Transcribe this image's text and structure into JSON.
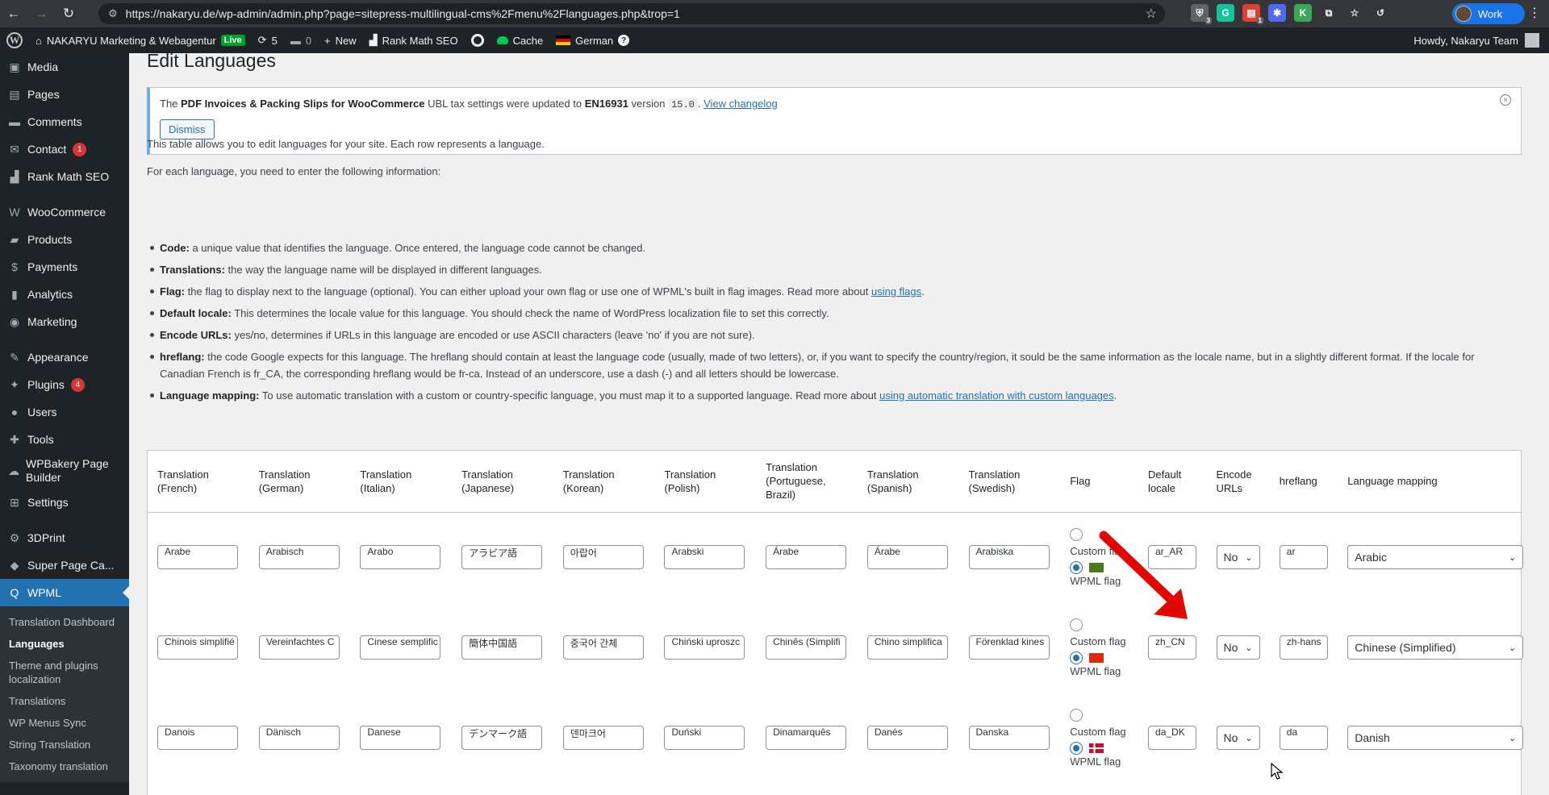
{
  "browser": {
    "url": "https://nakaryu.de/wp-admin/admin.php?page=sitepress-multilingual-cms%2Fmenu%2Flanguages.php&trop=1",
    "profile_label": "Work",
    "extensions": [
      {
        "icon": "shield-icon",
        "badge": "3",
        "color": "#5f6368",
        "glyph": "⛨"
      },
      {
        "icon": "grammarly-icon",
        "badge": "",
        "color": "#15c39a",
        "glyph": "G"
      },
      {
        "icon": "todoist-icon",
        "badge": "1",
        "color": "#db4035",
        "glyph": "▤"
      },
      {
        "icon": "puzzle-blue-icon",
        "badge": "",
        "color": "#4f6bed",
        "glyph": "✱"
      },
      {
        "icon": "k-icon",
        "badge": "",
        "color": "#3aa757",
        "glyph": "K"
      },
      {
        "icon": "extensions-icon",
        "badge": "",
        "color": "#35363a",
        "glyph": "⧉"
      }
    ]
  },
  "adminbar": {
    "site_name": "NAKARYU Marketing & Webagentur",
    "live_label": "Live",
    "updates_count": "5",
    "comments_count": "0",
    "new_label": "New",
    "rankmath_label": "Rank Math SEO",
    "cache_label": "Cache",
    "language_label": "German",
    "howdy": "Howdy, Nakaryu Team"
  },
  "sidebar": {
    "items": [
      {
        "label": "Media",
        "icon": "media-icon",
        "glyph": "▣",
        "badge": ""
      },
      {
        "label": "Pages",
        "icon": "pages-icon",
        "glyph": "▤",
        "badge": ""
      },
      {
        "label": "Comments",
        "icon": "comments-icon",
        "glyph": "▬",
        "badge": ""
      },
      {
        "label": "Contact",
        "icon": "mail-icon",
        "glyph": "✉",
        "badge": "1"
      },
      {
        "label": "Rank Math SEO",
        "icon": "rankmath-icon",
        "glyph": "▟",
        "badge": ""
      }
    ],
    "items2": [
      {
        "label": "WooCommerce",
        "icon": "woocommerce-icon",
        "glyph": "W",
        "badge": ""
      },
      {
        "label": "Products",
        "icon": "products-icon",
        "glyph": "▰",
        "badge": ""
      },
      {
        "label": "Payments",
        "icon": "payments-icon",
        "glyph": "$",
        "badge": ""
      },
      {
        "label": "Analytics",
        "icon": "analytics-icon",
        "glyph": "▮",
        "badge": ""
      },
      {
        "label": "Marketing",
        "icon": "marketing-icon",
        "glyph": "◉",
        "badge": ""
      }
    ],
    "items3": [
      {
        "label": "Appearance",
        "icon": "appearance-icon",
        "glyph": "✎",
        "badge": ""
      },
      {
        "label": "Plugins",
        "icon": "plugins-icon",
        "glyph": "✦",
        "badge": "4"
      },
      {
        "label": "Users",
        "icon": "users-icon",
        "glyph": "●",
        "badge": ""
      },
      {
        "label": "Tools",
        "icon": "tools-icon",
        "glyph": "✚",
        "badge": ""
      },
      {
        "label": "WPBakery Page Builder",
        "icon": "wpbakery-icon",
        "glyph": "☁",
        "badge": ""
      },
      {
        "label": "Settings",
        "icon": "settings-icon",
        "glyph": "⊞",
        "badge": ""
      }
    ],
    "items4": [
      {
        "label": "3DPrint",
        "icon": "gear-icon",
        "glyph": "⚙",
        "badge": ""
      },
      {
        "label": "Super Page Ca...",
        "icon": "super-cache-icon",
        "glyph": "◆",
        "badge": ""
      }
    ],
    "current": {
      "label": "WPML",
      "icon": "wpml-icon",
      "glyph": "Q"
    },
    "submenu": [
      "Translation Dashboard",
      "Languages",
      "Theme and plugins localization",
      "Translations",
      "WP Menus Sync",
      "String Translation",
      "Taxonomy translation"
    ]
  },
  "page": {
    "title": "Edit Languages",
    "notice": {
      "text_1": "The ",
      "bold_1": "PDF Invoices & Packing Slips for WooCommerce",
      "text_2": " UBL tax settings were updated to ",
      "bold_2": "EN16931",
      "text_3": " version ",
      "code": "15.0",
      "text_4": ". ",
      "link": "View changelog",
      "dismiss": "Dismiss"
    },
    "intro_1": "This table allows you to edit languages for your site. Each row represents a language.",
    "intro_2": "For each language, you need to enter the following information:",
    "info": [
      {
        "term": "Code:",
        "desc": " a unique value that identifies the language. Once entered, the language code cannot be changed.",
        "link": "",
        "after": ""
      },
      {
        "term": "Translations:",
        "desc": " the way the language name will be displayed in different languages.",
        "link": "",
        "after": ""
      },
      {
        "term": "Flag:",
        "desc": " the flag to display next to the language (optional). You can either upload your own flag or use one of WPML's built in flag images. Read more about ",
        "link": "using flags",
        "after": "."
      },
      {
        "term": "Default locale:",
        "desc": " This determines the locale value for this language. You should check the name of WordPress localization file to set this correctly.",
        "link": "",
        "after": ""
      },
      {
        "term": "Encode URLs:",
        "desc": " yes/no, determines if URLs in this language are encoded or use ASCII characters (leave 'no' if you are not sure).",
        "link": "",
        "after": ""
      },
      {
        "term": "hreflang:",
        "desc": " the code Google expects for this language. The hreflang should contain at least the language code (usually, made of two letters), or, if you want to specify the country/region, it sould be the same information as the locale name, but in a slightly different format. If the locale for Canadian French is fr_CA, the corresponding hreflang would be fr-ca. Instead of an underscore, use a dash (-) and all letters should be lowercase.",
        "link": "",
        "after": ""
      },
      {
        "term": "Language mapping:",
        "desc": " To use automatic translation with a custom or country-specific language, you must map it to a supported language. Read more about ",
        "link": "using automatic translation with custom languages",
        "after": "."
      }
    ]
  },
  "table": {
    "headers": [
      "Translation (French)",
      "Translation (German)",
      "Translation (Italian)",
      "Translation (Japanese)",
      "Translation (Korean)",
      "Translation (Polish)",
      "Translation (Portuguese, Brazil)",
      "Translation (Spanish)",
      "Translation (Swedish)",
      "Flag",
      "Default locale",
      "Encode URLs",
      "hreflang",
      "Language mapping"
    ],
    "custom_flag_label": "Custom flag",
    "wpml_flag_label": "WPML flag",
    "rows": [
      {
        "translations": [
          "Arabe",
          "Arabisch",
          "Arabo",
          "アラビア語",
          "아랍어",
          "Arabski",
          "Árabe",
          "Árabe",
          "Arabiska"
        ],
        "flag": "flag-ar",
        "locale": "ar_AR",
        "encode": "No",
        "hreflang": "ar",
        "mapping": "Arabic"
      },
      {
        "translations": [
          "Chinois simplifié",
          "Vereinfachtes C",
          "Cinese semplific",
          "簡体中国語",
          "중국어 간체",
          "Chiński uproszc",
          "Chinês (Simplifi",
          "Chino simplifica",
          "Förenklad kines"
        ],
        "flag": "flag-cn",
        "locale": "zh_CN",
        "encode": "No",
        "hreflang": "zh-hans",
        "mapping": "Chinese (Simplified)"
      },
      {
        "translations": [
          "Danois",
          "Dänisch",
          "Danese",
          "デンマーク語",
          "덴마크어",
          "Duński",
          "Dinamarquês",
          "Danés",
          "Danska"
        ],
        "flag": "flag-dk",
        "locale": "da_DK",
        "encode": "No",
        "hreflang": "da",
        "mapping": "Danish"
      }
    ]
  },
  "colors": {
    "accent": "#2271b1",
    "sidebar": "#1d2327",
    "badge": "#d63638",
    "annotation_arrow": "#e10600"
  }
}
